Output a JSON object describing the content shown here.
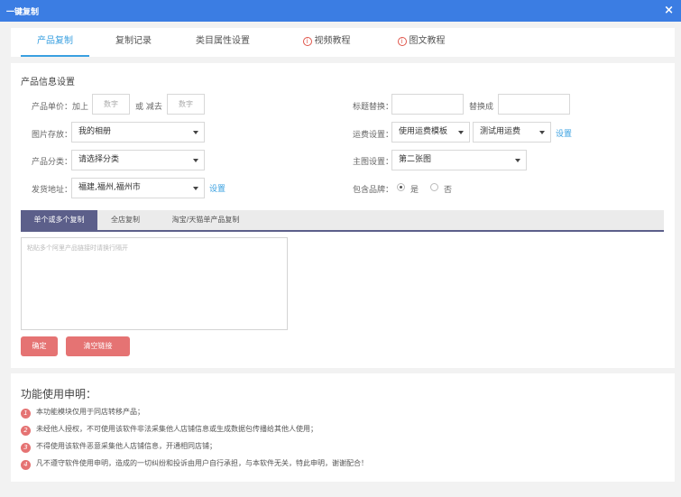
{
  "window": {
    "title": "一键复制",
    "close_icon": "×"
  },
  "tabs": [
    {
      "label": "产品复制",
      "active": true
    },
    {
      "label": "复制记录"
    },
    {
      "label": "类目属性设置"
    },
    {
      "label": "视频教程",
      "icon": "info-icon"
    },
    {
      "label": "图文教程",
      "icon": "info-icon"
    }
  ],
  "product_settings": {
    "title": "产品信息设置",
    "price": {
      "label": "产品单价：加上",
      "add_placeholder": "数字",
      "or_minus": "或 减去",
      "minus_placeholder": "数字"
    },
    "image_store": {
      "label": "图片存放：",
      "value": "我的相册"
    },
    "category": {
      "label": "产品分类：",
      "value": "请选择分类"
    },
    "ship_address": {
      "label": "发货地址：",
      "value": "福建,福州,福州市",
      "link": "设置"
    },
    "title_replace": {
      "label": "标题替换：",
      "replace_with": "替换成"
    },
    "freight": {
      "label": "运费设置：",
      "template": "使用运费模板",
      "value": "测试用运费",
      "link": "设置"
    },
    "main_image": {
      "label": "主图设置：",
      "value": "第二张图"
    },
    "include_brand": {
      "label": "包含品牌：",
      "yes": "是",
      "no": "否",
      "selected": "是"
    }
  },
  "copy_modes": [
    {
      "label": "单个或多个复制",
      "active": true
    },
    {
      "label": "全店复制"
    },
    {
      "label": "淘宝/天猫单产品复制"
    }
  ],
  "links_input": {
    "placeholder": "粘贴多个阿里产品链接时请换行隔开"
  },
  "buttons": {
    "confirm": "确定",
    "clear": "清空链接"
  },
  "notice": {
    "title": "功能使用申明：",
    "items": [
      "本功能模块仅用于同店转移产品；",
      "未经他人授权，不可使用该软件非法采集他人店铺信息或生成数据包传播给其他人使用；",
      "不得使用该软件恶意采集他人店铺信息，开通相同店铺；",
      "凡不遵守软件使用申明，造成的一切纠纷和投诉由用户自行承担，与本软件无关，特此申明，谢谢配合！"
    ],
    "numbers": [
      "1",
      "2",
      "3",
      "4"
    ]
  },
  "colors": {
    "titlebar": "#3b7de3",
    "accent": "#3aa0e0",
    "button": "#e57373",
    "subtab_active": "#5c5f8a"
  }
}
